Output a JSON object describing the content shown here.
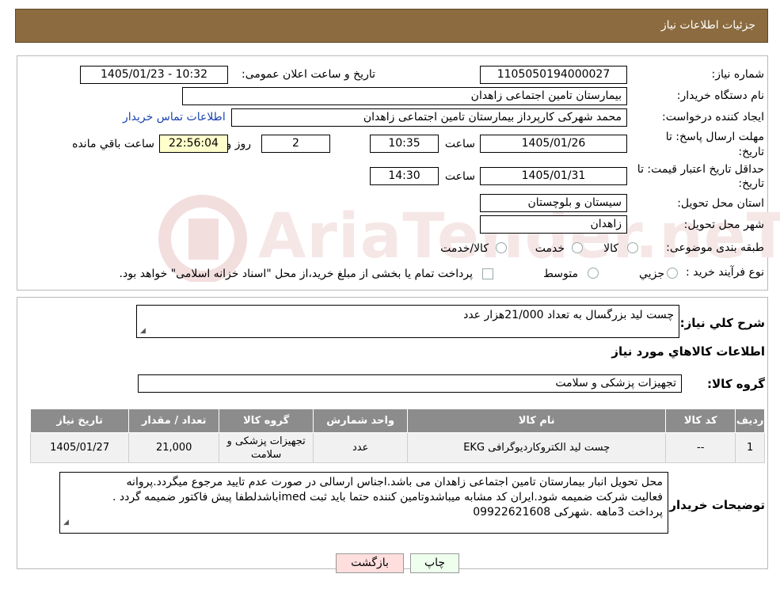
{
  "header": {
    "title": "جزئیات اطلاعات نیاز"
  },
  "watermark": {
    "text": "AriaTender.neT"
  },
  "fields": {
    "need_number_label": "شماره نیاز:",
    "need_number": "1105050194000027",
    "announce_label": "تاریخ و ساعت اعلان عمومی:",
    "announce_value": "1405/01/23 - 10:32",
    "buyer_org_label": "نام دستگاه خریدار:",
    "buyer_org": "بیمارستان تامین اجتماعی زاهدان",
    "creator_label": "ایجاد کننده درخواست:",
    "creator": "محمد شهرکی کارپرداز بیمارستان تامین اجتماعی زاهدان",
    "contact_link": "اطلاعات تماس خریدار",
    "reply_deadline_label_1": "مهلت ارسال پاسخ: تا",
    "reply_deadline_label_2": "تاریخ:",
    "reply_date": "1405/01/26",
    "time_label": "ساعت",
    "reply_time": "10:35",
    "days_value": "2",
    "days_label": "روز و",
    "remaining_time": "22:56:04",
    "remaining_label": "ساعت باقي مانده",
    "price_validity_label_1": "حداقل تاریخ اعتبار قیمت: تا",
    "price_validity_label_2": "تاریخ:",
    "price_validity_date": "1405/01/31",
    "price_validity_time": "14:30",
    "province_label": "استان محل تحویل:",
    "province": "سیستان و بلوچستان",
    "city_label": "شهر محل تحویل:",
    "city": "زاهدان",
    "category_label": "طبقه بندی موضوعی:",
    "category_options": [
      "کالا",
      "خدمت",
      "کالا/خدمت"
    ],
    "process_label": "نوع فرآیند خرید :",
    "process_options": [
      "جزیي",
      "متوسط"
    ],
    "process_note": "پرداخت تمام یا بخشی از مبلغ خرید،از محل \"اسناد خزانه اسلامی\" خواهد بود."
  },
  "summary": {
    "label": "شرح کلي نياز:",
    "value": "چست لید بزرگسال به تعداد 21/000هزار عدد",
    "goods_info_title": "اطلاعات کالاهاي مورد نياز",
    "group_label": "گروه کالا:",
    "group_value": "تجهیزات پزشکی و سلامت"
  },
  "table": {
    "headers": [
      "رديف",
      "کد کالا",
      "نام کالا",
      "واحد شمارش",
      "گروه کالا",
      "تعداد / مقدار",
      "تاریخ نیاز"
    ],
    "rows": [
      {
        "index": "1",
        "code": "--",
        "name": "چست لید الکتروکاردیوگرافی EKG",
        "unit": "عدد",
        "group": "تجهیزات پزشکی و سلامت",
        "qty": "21,000",
        "date": "1405/01/27"
      }
    ]
  },
  "notes": {
    "label": "توضیحات خریدار:",
    "lines": [
      "محل تحویل انبار بیمارستان تامین اجتماعی زاهدان می باشد.اجناس ارسالی در صورت عدم تایید مرجوع میگردد.پروانه",
      "فعالیت شرکت ضمیمه شود.ایران کد مشابه میباشدوتامین کننده حتما باید ثبت imedباشدلطفا پیش فاکتور ضمیمه گردد .",
      "پرداخت 3ماهه  .شهرکی 09922621608"
    ]
  },
  "buttons": {
    "print": "چاپ",
    "back": "بازگشت"
  }
}
